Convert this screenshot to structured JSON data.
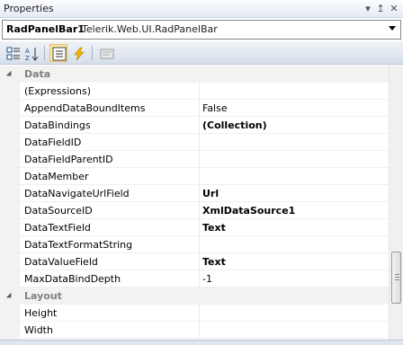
{
  "window": {
    "title": "Properties"
  },
  "selector": {
    "object_name": "RadPanelBar1",
    "object_type": "Telerik.Web.UI.RadPanelBar"
  },
  "toolbar": {
    "buttons": [
      {
        "icon": "categorized-icon"
      },
      {
        "icon": "alphabetical-sort-icon"
      },
      {
        "icon": "properties-icon",
        "active": true
      },
      {
        "icon": "events-lightning-icon"
      },
      {
        "icon": "property-pages-icon"
      }
    ]
  },
  "categories": [
    {
      "label": "Data",
      "properties": [
        {
          "name": "(Expressions)",
          "value": ""
        },
        {
          "name": "AppendDataBoundItems",
          "value": "False"
        },
        {
          "name": "DataBindings",
          "value": "(Collection)"
        },
        {
          "name": "DataFieldID",
          "value": ""
        },
        {
          "name": "DataFieldParentID",
          "value": ""
        },
        {
          "name": "DataMember",
          "value": ""
        },
        {
          "name": "DataNavigateUrlField",
          "value": "Url"
        },
        {
          "name": "DataSourceID",
          "value": "XmlDataSource1"
        },
        {
          "name": "DataTextField",
          "value": "Text"
        },
        {
          "name": "DataTextFormatString",
          "value": ""
        },
        {
          "name": "DataValueField",
          "value": "Text"
        },
        {
          "name": "MaxDataBindDepth",
          "value": "-1"
        }
      ]
    },
    {
      "label": "Layout",
      "properties": [
        {
          "name": "Height",
          "value": ""
        },
        {
          "name": "Width",
          "value": ""
        }
      ]
    }
  ],
  "bold_values": [
    "(Collection)",
    "Url",
    "XmlDataSource1",
    "Text"
  ],
  "colors": {
    "category_text": "#808080",
    "active_tool": "#fbe6a8"
  }
}
